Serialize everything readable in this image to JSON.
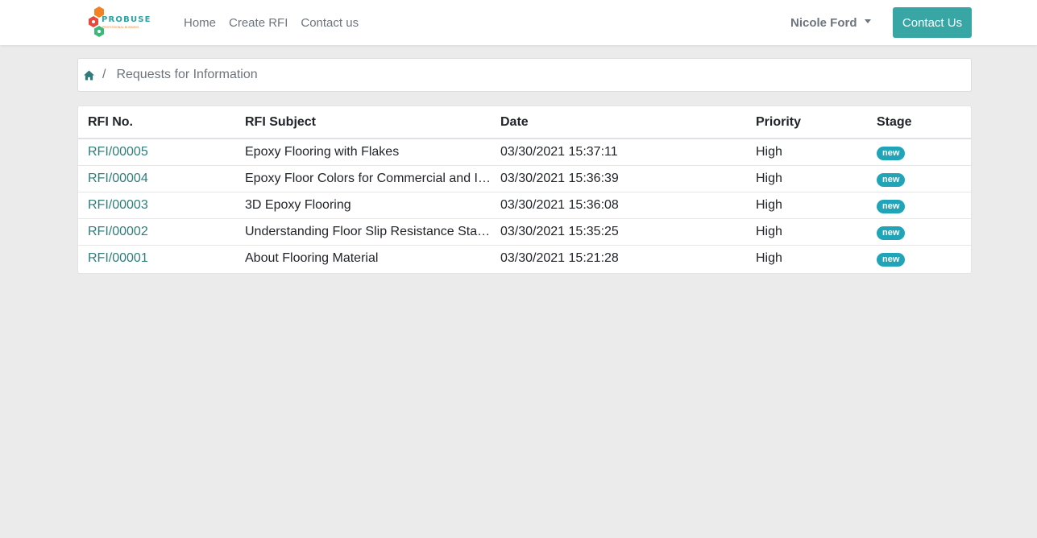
{
  "navbar": {
    "logo_text": "PROBUSE",
    "logo_sub": "PROFESSIONAL BUSINESS",
    "links": [
      "Home",
      "Create RFI",
      "Contact us"
    ],
    "user_name": "Nicole Ford",
    "contact_button": "Contact Us"
  },
  "breadcrumb": {
    "separator": "/",
    "current": "Requests for Information"
  },
  "table": {
    "headers": [
      "RFI No.",
      "RFI Subject",
      "Date",
      "Priority",
      "Stage"
    ],
    "rows": [
      {
        "number": "RFI/00005",
        "subject": "Epoxy Flooring with Flakes",
        "date": "03/30/2021 15:37:11",
        "priority": "High",
        "stage": "new"
      },
      {
        "number": "RFI/00004",
        "subject": "Epoxy Floor Colors for Commercial and Industrial Use",
        "date": "03/30/2021 15:36:39",
        "priority": "High",
        "stage": "new"
      },
      {
        "number": "RFI/00003",
        "subject": "3D Epoxy Flooring",
        "date": "03/30/2021 15:36:08",
        "priority": "High",
        "stage": "new"
      },
      {
        "number": "RFI/00002",
        "subject": "Understanding Floor Slip Resistance Standards",
        "date": "03/30/2021 15:35:25",
        "priority": "High",
        "stage": "new"
      },
      {
        "number": "RFI/00001",
        "subject": "About Flooring Material",
        "date": "03/30/2021 15:21:28",
        "priority": "High",
        "stage": "new"
      }
    ]
  },
  "colors": {
    "accent": "#37a6a4",
    "link": "#2e7d7a",
    "badge": "#20a4b8",
    "background": "#ebebeb"
  }
}
